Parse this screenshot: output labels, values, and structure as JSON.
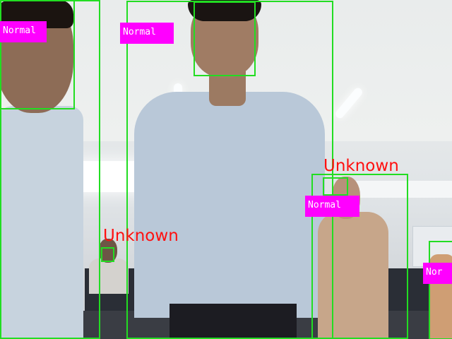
{
  "image": {
    "description_none": ""
  },
  "overlay": {
    "box_color": "#22dd22",
    "tag_color": "#ff00ff",
    "tag_text_color": "#ffffff",
    "unknown_color": "#ff1010"
  },
  "detections": [
    {
      "label": "Normal"
    },
    {
      "label": "Normal"
    },
    {
      "label": "Normal"
    },
    {
      "label": "Nor"
    },
    {
      "label": "Unknown"
    },
    {
      "label": "Unknown"
    }
  ]
}
